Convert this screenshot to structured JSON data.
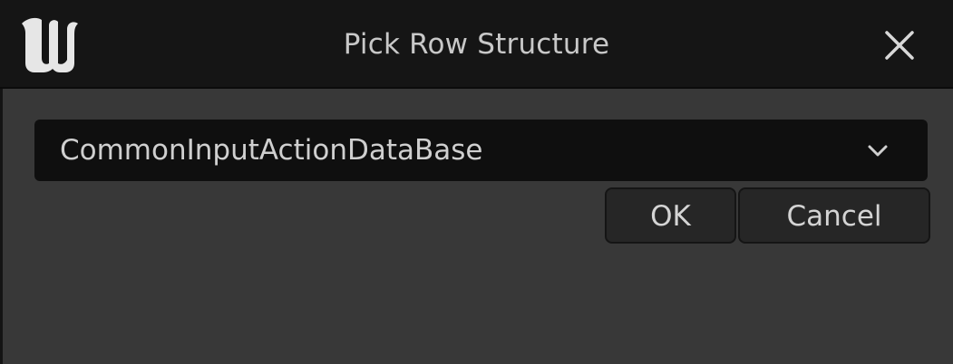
{
  "window": {
    "title": "Pick Row Structure",
    "logo_icon": "unreal-engine-logo-icon",
    "close_icon": "close-icon"
  },
  "row_structure_picker": {
    "selected_value": "CommonInputActionDataBase",
    "dropdown_icon": "chevron-down-icon"
  },
  "buttons": {
    "ok_label": "OK",
    "cancel_label": "Cancel"
  },
  "colors": {
    "titlebar_bg": "#151515",
    "body_bg": "#383838",
    "combo_bg": "#0f0f0f",
    "button_bg": "#262626",
    "text": "#cfcfcf"
  }
}
